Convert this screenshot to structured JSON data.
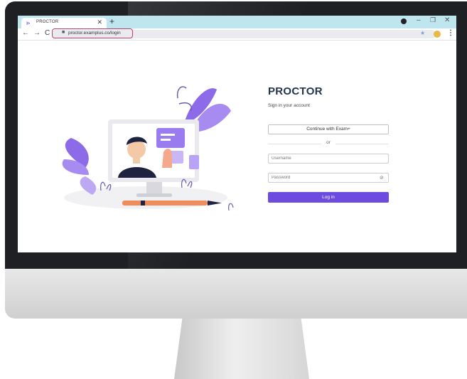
{
  "browser": {
    "tab_title": "PROCTOR",
    "url": "proctor.examplus.co/login",
    "icons": {
      "tab_favicon": "proctor-logo-icon",
      "tab_close": "close-icon",
      "new_tab": "plus-icon",
      "back": "arrow-left-icon",
      "forward": "arrow-right-icon",
      "reload": "reload-icon",
      "lock": "lock-icon",
      "bookmark": "star-icon",
      "menu": "kebab-menu-icon"
    }
  },
  "login": {
    "title": "PROCTOR",
    "subtitle": "Sign in your account",
    "sso_button": "Continue with Exam+",
    "divider": "or",
    "username_placeholder": "Username",
    "password_placeholder": "Password",
    "submit": "Log in"
  },
  "colors": {
    "accent": "#6c4bde",
    "title": "#24344d",
    "tab_strip": "#bfe5ee",
    "url_highlight": "#c03a6b"
  }
}
